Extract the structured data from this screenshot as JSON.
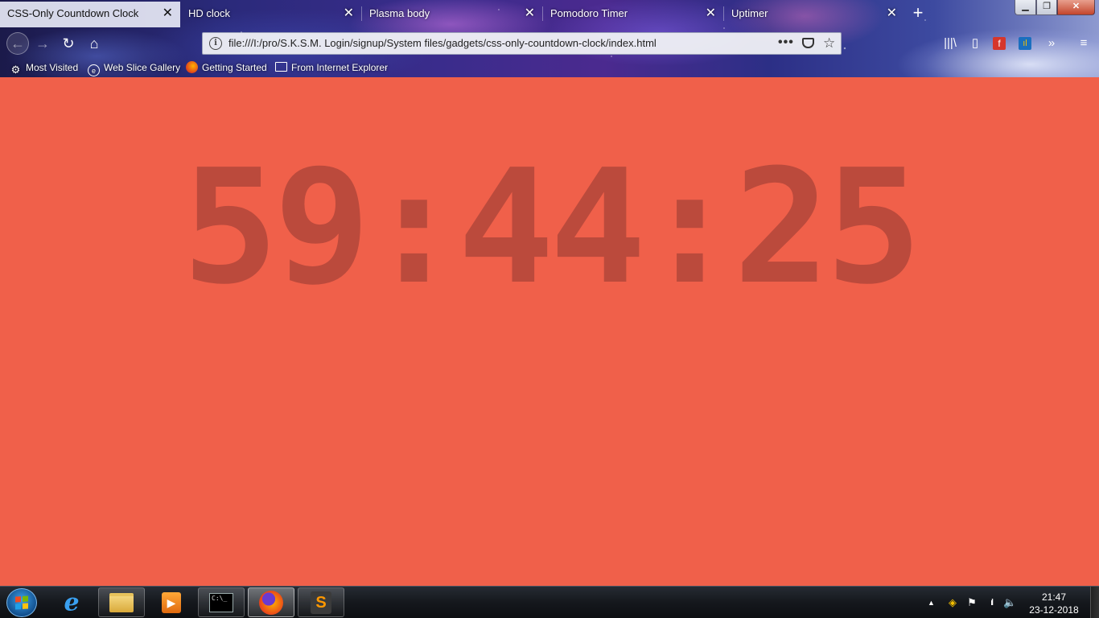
{
  "browser": {
    "tabs": [
      {
        "title": "CSS-Only Countdown Clock",
        "active": true
      },
      {
        "title": "HD clock",
        "active": false
      },
      {
        "title": "Plasma body",
        "active": false
      },
      {
        "title": "Pomodoro Timer",
        "active": false
      },
      {
        "title": "Uptimer",
        "active": false
      }
    ],
    "tab_close_glyph": "✕",
    "new_tab_glyph": "+",
    "window_controls": {
      "minimize": "▁",
      "maximize": "❐",
      "close": "✕"
    },
    "nav": {
      "back": "←",
      "forward": "→",
      "reload": "↻",
      "home": "⌂"
    },
    "url": "file:///I:/pro/S.K.S.M. Login/signup/System files/gadgets/css-only-countdown-clock/index.html",
    "url_info_glyph": "i",
    "page_actions_glyph": "•••",
    "bookmark_star_glyph": "☆",
    "toolbar_icons": {
      "library": "|||\\",
      "sidebar": "▯",
      "flash": "f",
      "stats": "ıl",
      "overflow": "»",
      "menu": "≡"
    },
    "bookmarks": [
      {
        "label": "Most Visited",
        "icon": "gear-icon",
        "glyph": "⚙"
      },
      {
        "label": "Web Slice Gallery",
        "icon": "globe-icon",
        "glyph": "e"
      },
      {
        "label": "Getting Started",
        "icon": "firefox-icon",
        "glyph": ""
      },
      {
        "label": "From Internet Explorer",
        "icon": "folder-icon",
        "glyph": ""
      }
    ]
  },
  "page": {
    "background_color": "#f0604a",
    "digit_color": "#bb4a3c",
    "countdown": "59:44:25"
  },
  "taskbar": {
    "apps": [
      {
        "name": "internet-explorer",
        "glyph": "e"
      },
      {
        "name": "file-explorer",
        "glyph": ""
      },
      {
        "name": "media-player",
        "glyph": "▶"
      },
      {
        "name": "command-prompt",
        "glyph": "C:\\_"
      },
      {
        "name": "firefox",
        "glyph": ""
      },
      {
        "name": "sublime-text",
        "glyph": "S"
      }
    ],
    "tray": {
      "arrow": "▲",
      "icon1": "◈",
      "flag": "⚑",
      "signal": "ıll",
      "volume": "🔈"
    },
    "time": "21:47",
    "date": "23-12-2018"
  }
}
